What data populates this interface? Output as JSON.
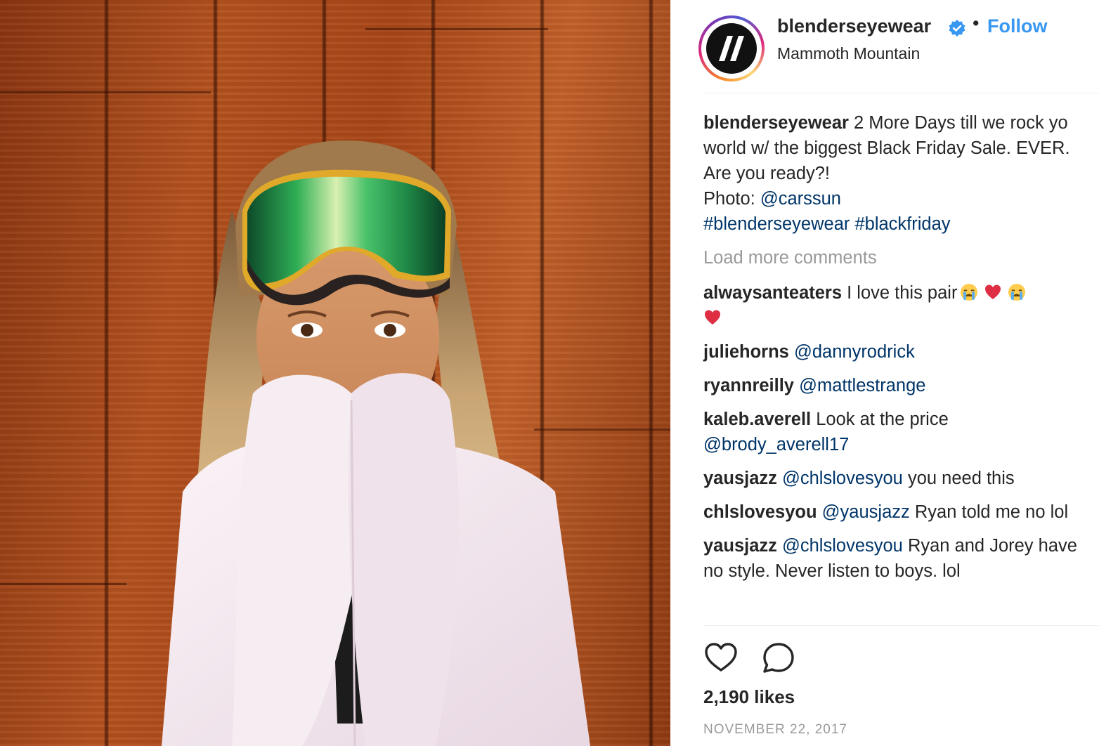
{
  "post": {
    "username": "blenderseyewear",
    "location": "Mammoth Mountain",
    "follow_label": "Follow",
    "separator": "•"
  },
  "caption": {
    "user": "blenderseyewear",
    "text": " 2 More Days till we rock yo world w/ the biggest Black Friday Sale. EVER. Are you ready?!",
    "photo_prefix": "Photo: ",
    "photo_credit": "@carssun",
    "hashtags": "#blenderseyewear #blackfriday"
  },
  "load_more": "Load more comments",
  "comments": [
    {
      "user": "alwaysanteaters",
      "text": " I love this pair",
      "emojis_after": [
        "crying-face",
        "red-heart",
        "crying-face",
        "red-heart"
      ]
    },
    {
      "user": "juliehorns",
      "mention": "@dannyrodrick",
      "text": ""
    },
    {
      "user": "ryannreilly",
      "mention": "@mattlestrange",
      "text": ""
    },
    {
      "user": "kaleb.averell",
      "pre": " Look at the price ",
      "mention": "@brody_averell17",
      "text": ""
    },
    {
      "user": "yausjazz",
      "mention": "@chlslovesyou",
      "text": " you need this"
    },
    {
      "user": "chlslovesyou",
      "mention": "@yausjazz",
      "text": " Ryan told me no lol"
    },
    {
      "user": "yausjazz",
      "mention": "@chlslovesyou",
      "text": " Ryan and Jorey have no style. Never listen to boys. lol"
    }
  ],
  "likes": "2,190 likes",
  "date": "NOVEMBER 22, 2017",
  "icons": {
    "verified": "verified-badge-icon",
    "like": "heart-icon",
    "comment": "comment-bubble-icon",
    "avatar": "blenders-logo"
  },
  "colors": {
    "link": "#3897f0",
    "mention": "#003569",
    "muted": "#999999",
    "text": "#262626",
    "wood": "#b4521f",
    "goggle_lens": "#2fae55",
    "sweater": "#f3e8ef"
  }
}
